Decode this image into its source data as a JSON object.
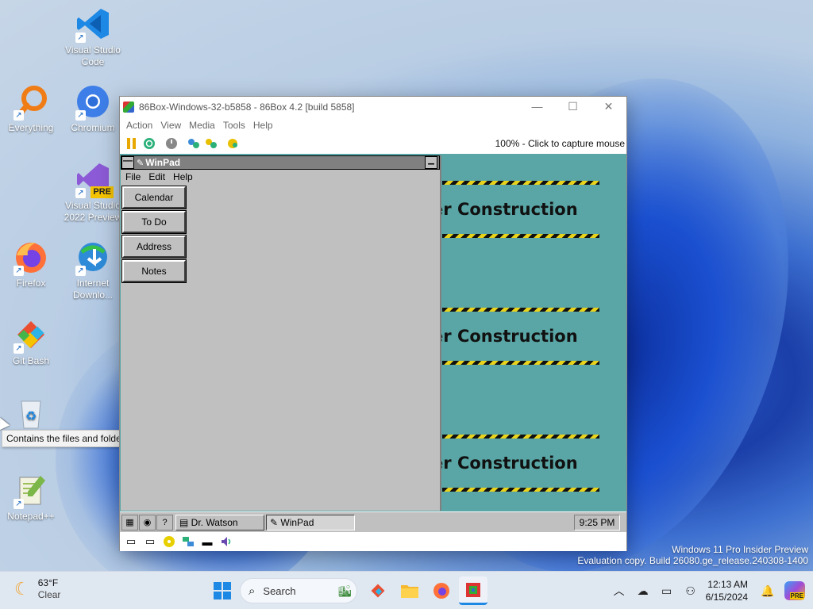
{
  "desktop": {
    "icons": [
      {
        "label": "Visual Studio Code",
        "icon": "vscode-icon"
      },
      {
        "label": "Everything",
        "icon": "everything-search-icon"
      },
      {
        "label": "Chromium",
        "icon": "chromium-icon"
      },
      {
        "label": "Visual Studio 2022 Preview",
        "icon": "visual-studio-icon"
      },
      {
        "label": "Firefox",
        "icon": "firefox-icon"
      },
      {
        "label": "Internet Downlo...",
        "icon": "internet-download-manager-icon"
      },
      {
        "label": "Git Bash",
        "icon": "git-bash-icon"
      },
      {
        "label": "",
        "icon": "recycle-bin-icon"
      },
      {
        "label": "Notepad++",
        "icon": "notepadpp-icon"
      }
    ],
    "vs_badge": "PRE",
    "tooltip": "Contains the files and folders that you have deleted."
  },
  "emulator": {
    "title": "86Box-Windows-32-b5858 - 86Box 4.2 [build 5858]",
    "menu": [
      "Action",
      "View",
      "Media",
      "Tools",
      "Help"
    ],
    "status": "100% - Click to capture mouse",
    "toolbar_icons": [
      "pause-icon",
      "reset-icon",
      "power-icon",
      "settings-icon",
      "settings-alt-icon",
      "ctrl-alt-del-icon"
    ]
  },
  "guest": {
    "banner_text": "Under Construction",
    "winpad": {
      "title": "WinPad",
      "menu": [
        "File",
        "Edit",
        "Help"
      ],
      "buttons": [
        "Calendar",
        "To Do",
        "Address",
        "Notes"
      ]
    },
    "taskbar": {
      "tasks": [
        "Dr. Watson",
        "WinPad"
      ],
      "clock": "9:25 PM"
    }
  },
  "watermark": {
    "line1": "Windows 11 Pro Insider Preview",
    "line2": "Evaluation copy. Build 26080.ge_release.240308-1400"
  },
  "host_taskbar": {
    "weather_temp": "63°F",
    "weather_desc": "Clear",
    "search_placeholder": "Search",
    "time": "12:13 AM",
    "date": "6/15/2024",
    "copilot_badge": "PRE"
  }
}
